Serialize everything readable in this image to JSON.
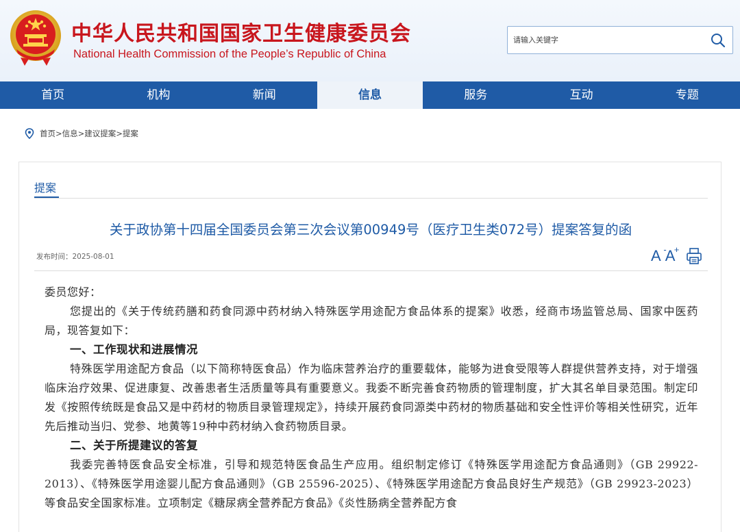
{
  "header": {
    "title_cn": "中华人民共和国国家卫生健康委员会",
    "title_en": "National Health Commission of the People’s Republic of China",
    "search_placeholder": "请输入关键字"
  },
  "nav": {
    "items": [
      "首页",
      "机构",
      "新闻",
      "信息",
      "服务",
      "互动",
      "专题"
    ],
    "active": "信息"
  },
  "breadcrumb": {
    "items": [
      "首页",
      "信息",
      "建议提案",
      "提案"
    ],
    "separator": ">"
  },
  "section": {
    "tab_label": "提案"
  },
  "article": {
    "title": "关于政协第十四届全国委员会第三次会议第00949号（医疗卫生类072号）提案答复的函",
    "date_label": "发布时间：",
    "date": "2025-08-01",
    "tools": {
      "font_decrease": "A",
      "font_increase": "A",
      "plus_sign": "+"
    },
    "greeting": "委员您好：",
    "paragraphs": [
      "您提出的《关于传统药膳和药食同源中药材纳入特殊医学用途配方食品体系的提案》收悉，经商市场监管总局、国家中医药局，现答复如下：",
      "一、工作现状和进展情况",
      "特殊医学用途配方食品（以下简称特医食品）作为临床营养治疗的重要载体，能够为进食受限等人群提供营养支持，对于增强临床治疗效果、促进康复、改善患者生活质量等具有重要意义。我委不断完善食药物质的管理制度，扩大其名单目录范围。制定印发《按照传统既是食品又是中药材的物质目录管理规定》，持续开展药食同源类中药材的物质基础和安全性评价等相关性研究，近年先后推动当归、党参、地黄等19种中药材纳入食药物质目录。",
      "二、关于所提建议的答复",
      "我委完善特医食品安全标准，引导和规范特医食品生产应用。组织制定修订《特殊医学用途配方食品通则》（GB 29922-2013）、《特殊医学用途婴儿配方食品通则》（GB 25596-2025）、《特殊医学用途配方食品良好生产规范》（GB 29923-2023）等食品安全国家标准。立项制定《糖尿病全营养配方食品》《炎性肠病全营养配方食"
    ]
  },
  "icons": {
    "emblem": "national-emblem-icon",
    "search": "search-icon",
    "location": "location-pin-icon",
    "print": "print-icon"
  },
  "colors": {
    "brand_red": "#c8161d",
    "brand_blue": "#1f5ba6",
    "active_nav_bg": "#eef3f9"
  }
}
